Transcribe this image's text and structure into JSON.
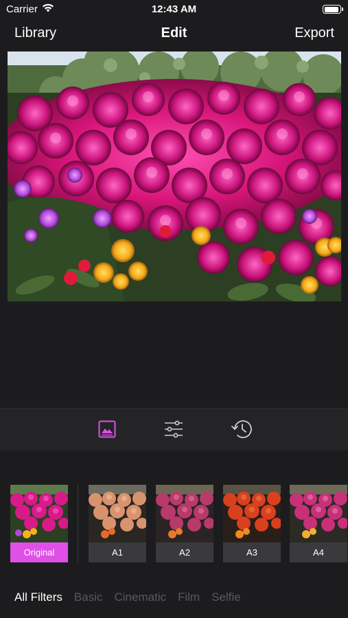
{
  "status": {
    "carrier": "Carrier",
    "time": "12:43 AM"
  },
  "nav": {
    "left": "Library",
    "title": "Edit",
    "right": "Export"
  },
  "toolbar": {
    "active_tool": "filters",
    "accent": "#e050e8",
    "icons": [
      "photo-filter-icon",
      "adjust-sliders-icon",
      "history-icon"
    ]
  },
  "filters": [
    {
      "label": "Original",
      "selected": true
    },
    {
      "label": "A1",
      "selected": false
    },
    {
      "label": "A2",
      "selected": false
    },
    {
      "label": "A3",
      "selected": false
    },
    {
      "label": "A4",
      "selected": false
    }
  ],
  "categories": [
    {
      "label": "All Filters",
      "active": true
    },
    {
      "label": "Basic",
      "active": false
    },
    {
      "label": "Cinematic",
      "active": false
    },
    {
      "label": "Film",
      "active": false
    },
    {
      "label": "Selfie",
      "active": false
    }
  ]
}
